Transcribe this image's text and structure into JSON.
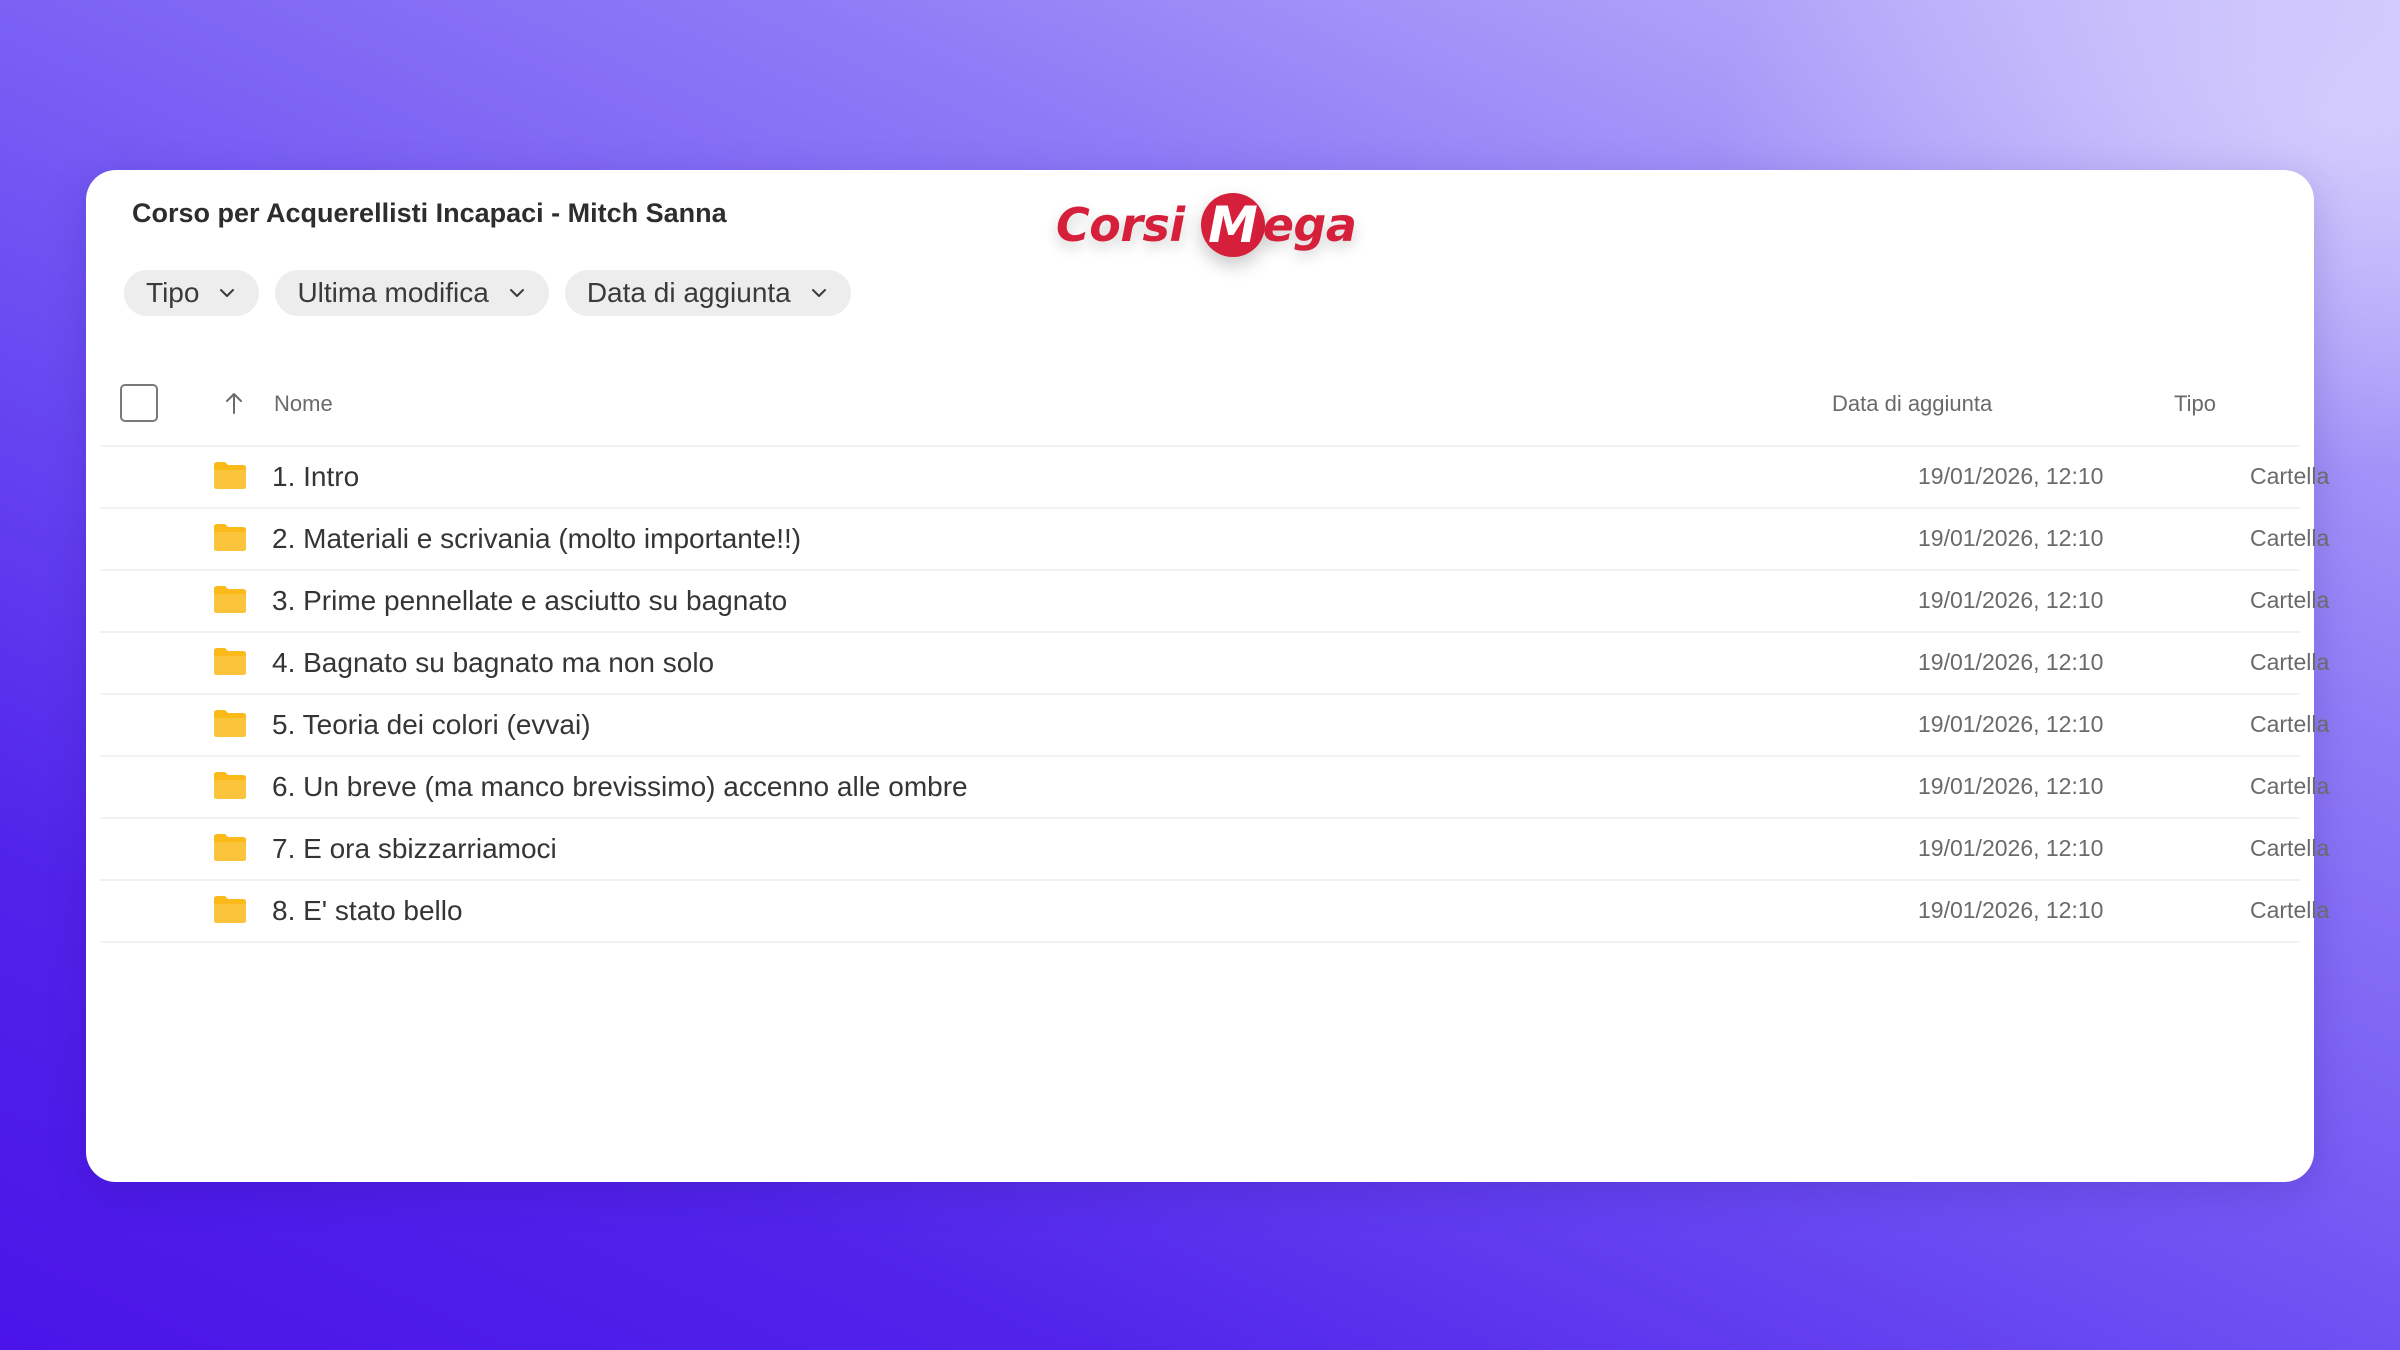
{
  "header": {
    "title": "Corso per Acquerellisti Incapaci - Mitch Sanna"
  },
  "logo": {
    "part1": "Corsi",
    "m": "M",
    "part2": "ega"
  },
  "filters": [
    {
      "label": "Tipo",
      "icon": "chevron-down-icon"
    },
    {
      "label": "Ultima modifica",
      "icon": "chevron-down-icon"
    },
    {
      "label": "Data di aggiunta",
      "icon": "chevron-down-icon"
    }
  ],
  "table": {
    "columns": {
      "name": "Nome",
      "date_added": "Data di aggiunta",
      "type": "Tipo"
    },
    "sort_icon": "arrow-up-icon",
    "rows": [
      {
        "name": "1. Intro",
        "date": "19/01/2026, 12:10",
        "type": "Cartella",
        "icon": "folder-icon"
      },
      {
        "name": "2. Materiali e scrivania (molto importante!!)",
        "date": "19/01/2026, 12:10",
        "type": "Cartella",
        "icon": "folder-icon"
      },
      {
        "name": "3. Prime pennellate e asciutto su bagnato",
        "date": "19/01/2026, 12:10",
        "type": "Cartella",
        "icon": "folder-icon"
      },
      {
        "name": "4. Bagnato su bagnato ma non solo",
        "date": "19/01/2026, 12:10",
        "type": "Cartella",
        "icon": "folder-icon"
      },
      {
        "name": "5. Teoria dei colori (evvai)",
        "date": "19/01/2026, 12:10",
        "type": "Cartella",
        "icon": "folder-icon"
      },
      {
        "name": "6. Un breve (ma manco brevissimo) accenno alle ombre",
        "date": "19/01/2026, 12:10",
        "type": "Cartella",
        "icon": "folder-icon"
      },
      {
        "name": "7. E ora sbizzarriamoci",
        "date": "19/01/2026, 12:10",
        "type": "Cartella",
        "icon": "folder-icon"
      },
      {
        "name": "8. E' stato bello",
        "date": "19/01/2026, 12:10",
        "type": "Cartella",
        "icon": "folder-icon"
      }
    ]
  },
  "colors": {
    "folder": "#fbb91a",
    "logo_red": "#d61f3a",
    "background_top": "#c6bdfb",
    "background_bottom": "#4a14e8"
  }
}
